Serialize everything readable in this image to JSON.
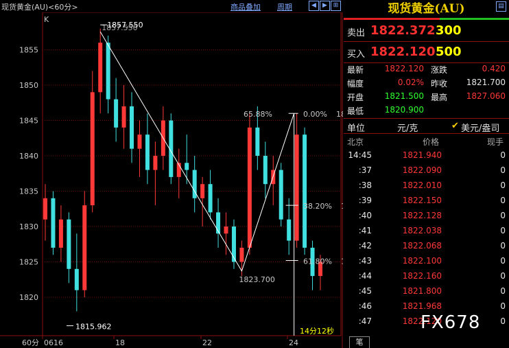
{
  "toolbar": {
    "title": "现货黄金(AU)<60分>",
    "overlay_label": "商品叠加",
    "period_label": "周期",
    "nav_icons": [
      "arrow-left-icon",
      "arrow-right-icon",
      "zoom-in-icon"
    ]
  },
  "chart_data": {
    "type": "candlestick",
    "period_label": "60分",
    "indicator_label": "K",
    "y_ticks": [
      1855,
      1850,
      1845,
      1840,
      1835,
      1830,
      1825,
      1820
    ],
    "x_ticks": [
      "0616",
      "18",
      "22",
      "24"
    ],
    "ylim": [
      1813,
      1860
    ],
    "high_marker": "1857.550",
    "high_marker_shadow": "1857.550",
    "low_marker": "1815.962",
    "swing_low_label": "1823.700",
    "fib_levels": [
      {
        "label": "65.88%"
      },
      {
        "label": "0.00%"
      },
      {
        "label": "38.20%"
      },
      {
        "label": "61.80%"
      }
    ],
    "fib_side_values": [
      "18",
      "1",
      "1"
    ],
    "countdown": "14分12秒",
    "colors": {
      "up": "#ff3838",
      "down": "#40e0e0",
      "lines": "#ffffff"
    },
    "candles": [
      [
        1831,
        1836,
        1828,
        1834
      ],
      [
        1834,
        1835,
        1826,
        1827
      ],
      [
        1827,
        1833,
        1825,
        1831
      ],
      [
        1831,
        1832,
        1822,
        1824
      ],
      [
        1824,
        1829,
        1818,
        1821
      ],
      [
        1821,
        1835,
        1820,
        1833
      ],
      [
        1833,
        1852,
        1832,
        1849
      ],
      [
        1849,
        1858,
        1846,
        1856
      ],
      [
        1856,
        1857,
        1846,
        1848
      ],
      [
        1848,
        1851,
        1842,
        1844
      ],
      [
        1844,
        1850,
        1841,
        1847
      ],
      [
        1847,
        1849,
        1839,
        1841
      ],
      [
        1841,
        1845,
        1837,
        1843
      ],
      [
        1843,
        1846,
        1836,
        1838
      ],
      [
        1838,
        1842,
        1833,
        1840
      ],
      [
        1840,
        1847,
        1838,
        1845
      ],
      [
        1845,
        1846,
        1836,
        1837
      ],
      [
        1837,
        1841,
        1834,
        1839
      ],
      [
        1839,
        1843,
        1836,
        1838
      ],
      [
        1838,
        1840,
        1832,
        1834
      ],
      [
        1834,
        1837,
        1830,
        1836
      ],
      [
        1836,
        1838,
        1831,
        1832
      ],
      [
        1832,
        1834,
        1827,
        1829
      ],
      [
        1829,
        1832,
        1826,
        1830
      ],
      [
        1830,
        1831,
        1824,
        1825
      ],
      [
        1825,
        1828,
        1823,
        1827
      ],
      [
        1827,
        1846,
        1826,
        1844
      ],
      [
        1844,
        1847,
        1838,
        1840
      ],
      [
        1840,
        1842,
        1834,
        1836
      ],
      [
        1836,
        1840,
        1833,
        1838
      ],
      [
        1838,
        1839,
        1830,
        1831
      ],
      [
        1831,
        1834,
        1826,
        1828
      ],
      [
        1828,
        1846,
        1827,
        1843
      ],
      [
        1843,
        1844,
        1826,
        1827
      ],
      [
        1827,
        1828,
        1821,
        1823
      ],
      [
        1823,
        1826,
        1821,
        1825
      ]
    ]
  },
  "panel": {
    "title": "现货黄金(AU)",
    "sell_label": "卖出",
    "sell_price": "1822.372",
    "sell_vol": "300",
    "buy_label": "买入",
    "buy_price": "1822.120",
    "buy_vol": "500",
    "stats": [
      {
        "k1": "最新",
        "v1": "1822.120",
        "k2": "涨跌",
        "v2": "0.420"
      },
      {
        "k1": "幅度",
        "v1": "0.02%",
        "k2": "昨收",
        "v2": "1821.700"
      },
      {
        "k1": "开盘",
        "v1": "1821.500",
        "k2": "最高",
        "v2": "1827.060"
      },
      {
        "k1": "最低",
        "v1": "1820.900",
        "k2": "",
        "v2": ""
      }
    ],
    "unit_label": "单位",
    "unit_value": "元/克",
    "usd_label": "美元/盎司",
    "ticks_header": {
      "col1": "北京",
      "col2": "价格",
      "col3": "现手"
    },
    "ticks": [
      {
        "time": "14:45",
        "price": "1821.940",
        "vol": "0"
      },
      {
        "time": ":37",
        "price": "1822.090",
        "vol": "0"
      },
      {
        "time": ":38",
        "price": "1822.010",
        "vol": "0"
      },
      {
        "time": ":39",
        "price": "1822.150",
        "vol": "0"
      },
      {
        "time": ":40",
        "price": "1822.128",
        "vol": "0"
      },
      {
        "time": ":41",
        "price": "1822.038",
        "vol": "0"
      },
      {
        "time": ":42",
        "price": "1822.068",
        "vol": "0"
      },
      {
        "time": ":43",
        "price": "1822.100",
        "vol": "0"
      },
      {
        "time": ":44",
        "price": "1822.160",
        "vol": "0"
      },
      {
        "time": ":45",
        "price": "1821.800",
        "vol": "0"
      },
      {
        "time": ":46",
        "price": "1821.968",
        "vol": "0"
      },
      {
        "time": ":47",
        "price": "1822.120",
        "vol": "0"
      }
    ],
    "footer_tab": "笔",
    "watermark": "FX678"
  }
}
